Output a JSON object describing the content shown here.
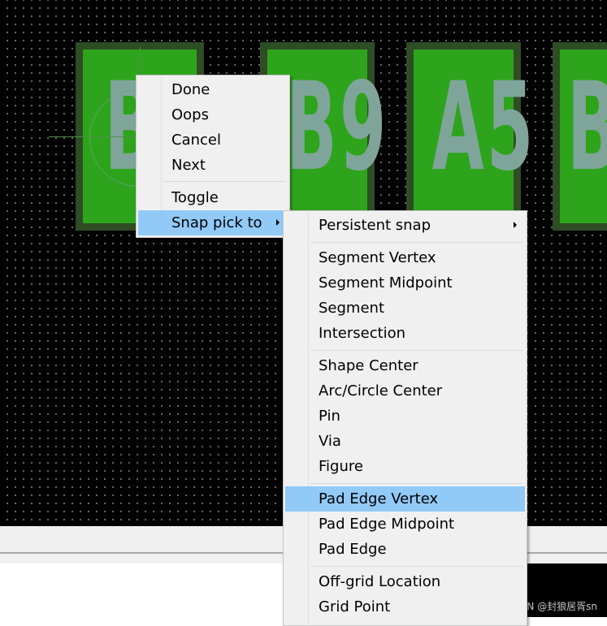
{
  "pads": [
    {
      "label": "B1"
    },
    {
      "label": "B9"
    },
    {
      "label": "A5"
    },
    {
      "label": "B"
    }
  ],
  "context_menu": {
    "items": [
      {
        "label": "Done"
      },
      {
        "label": "Oops"
      },
      {
        "label": "Cancel"
      },
      {
        "label": "Next"
      },
      {
        "label": "Toggle"
      },
      {
        "label": "Snap pick to"
      }
    ]
  },
  "snap_menu": {
    "items": [
      {
        "label": "Persistent snap"
      },
      {
        "label": "Segment Vertex"
      },
      {
        "label": "Segment Midpoint"
      },
      {
        "label": "Segment"
      },
      {
        "label": "Intersection"
      },
      {
        "label": "Shape Center"
      },
      {
        "label": "Arc/Circle Center"
      },
      {
        "label": "Pin"
      },
      {
        "label": "Via"
      },
      {
        "label": "Figure"
      },
      {
        "label": "Pad Edge Vertex"
      },
      {
        "label": "Pad Edge Midpoint"
      },
      {
        "label": "Pad Edge"
      },
      {
        "label": "Off-grid Location"
      },
      {
        "label": "Grid Point"
      }
    ]
  },
  "watermark": "CSDN @封狼居胥sn",
  "colors": {
    "canvas_bg": "#000000",
    "pad_fill": "#2ea41c",
    "pad_border": "#2e4d25",
    "pad_text": "#7fa59b",
    "menu_bg": "#f0f0f0",
    "menu_highlight": "#91c9f7"
  }
}
